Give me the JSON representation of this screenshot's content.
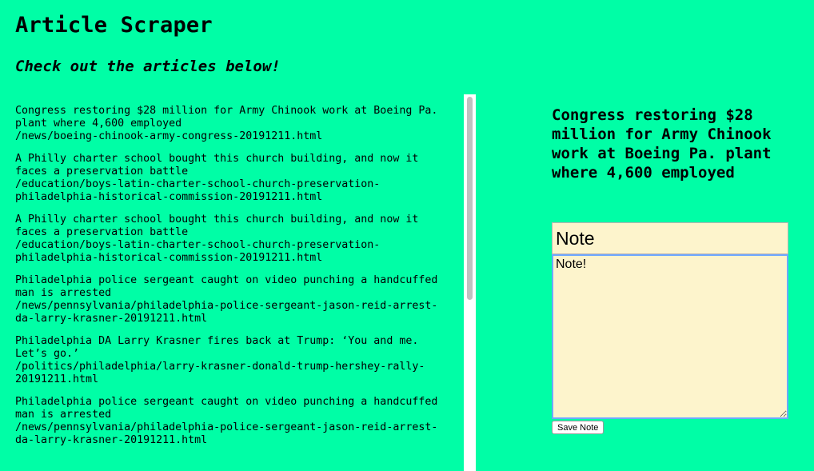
{
  "header": {
    "title": "Article Scraper",
    "subtitle": "Check out the articles below!"
  },
  "articles": [
    {
      "title": "Congress restoring $28 million for Army Chinook work at Boeing Pa. plant where 4,600 employed",
      "link": "/news/boeing-chinook-army-congress-20191211.html"
    },
    {
      "title": "A Philly charter school bought this church building, and now it faces a preservation battle",
      "link": "/education/boys-latin-charter-school-church-preservation-philadelphia-historical-commission-20191211.html"
    },
    {
      "title": "A Philly charter school bought this church building, and now it faces a preservation battle",
      "link": "/education/boys-latin-charter-school-church-preservation-philadelphia-historical-commission-20191211.html"
    },
    {
      "title": "Philadelphia police sergeant caught on video punching a handcuffed man is arrested",
      "link": "/news/pennsylvania/philadelphia-police-sergeant-jason-reid-arrest-da-larry-krasner-20191211.html"
    },
    {
      "title": "Philadelphia DA Larry Krasner fires back at Trump: ‘You and me. Let’s go.’",
      "link": "/politics/philadelphia/larry-krasner-donald-trump-hershey-rally-20191211.html"
    },
    {
      "title": "Philadelphia police sergeant caught on video punching a handcuffed man is arrested",
      "link": "/news/pennsylvania/philadelphia-police-sergeant-jason-reid-arrest-da-larry-krasner-20191211.html"
    }
  ],
  "note_panel": {
    "article_title": "Congress restoring $28 million for Army Chinook work at Boeing Pa. plant where 4,600 employed",
    "note_title_value": "Note",
    "note_body_value": "Note!",
    "save_label": "Save Note"
  },
  "colors": {
    "background": "#00fea6",
    "input_background": "#fdf4cc",
    "focus_border": "#6fa8ff",
    "scrollbar_track": "#ffffff",
    "scrollbar_thumb": "#c1c1c1"
  }
}
